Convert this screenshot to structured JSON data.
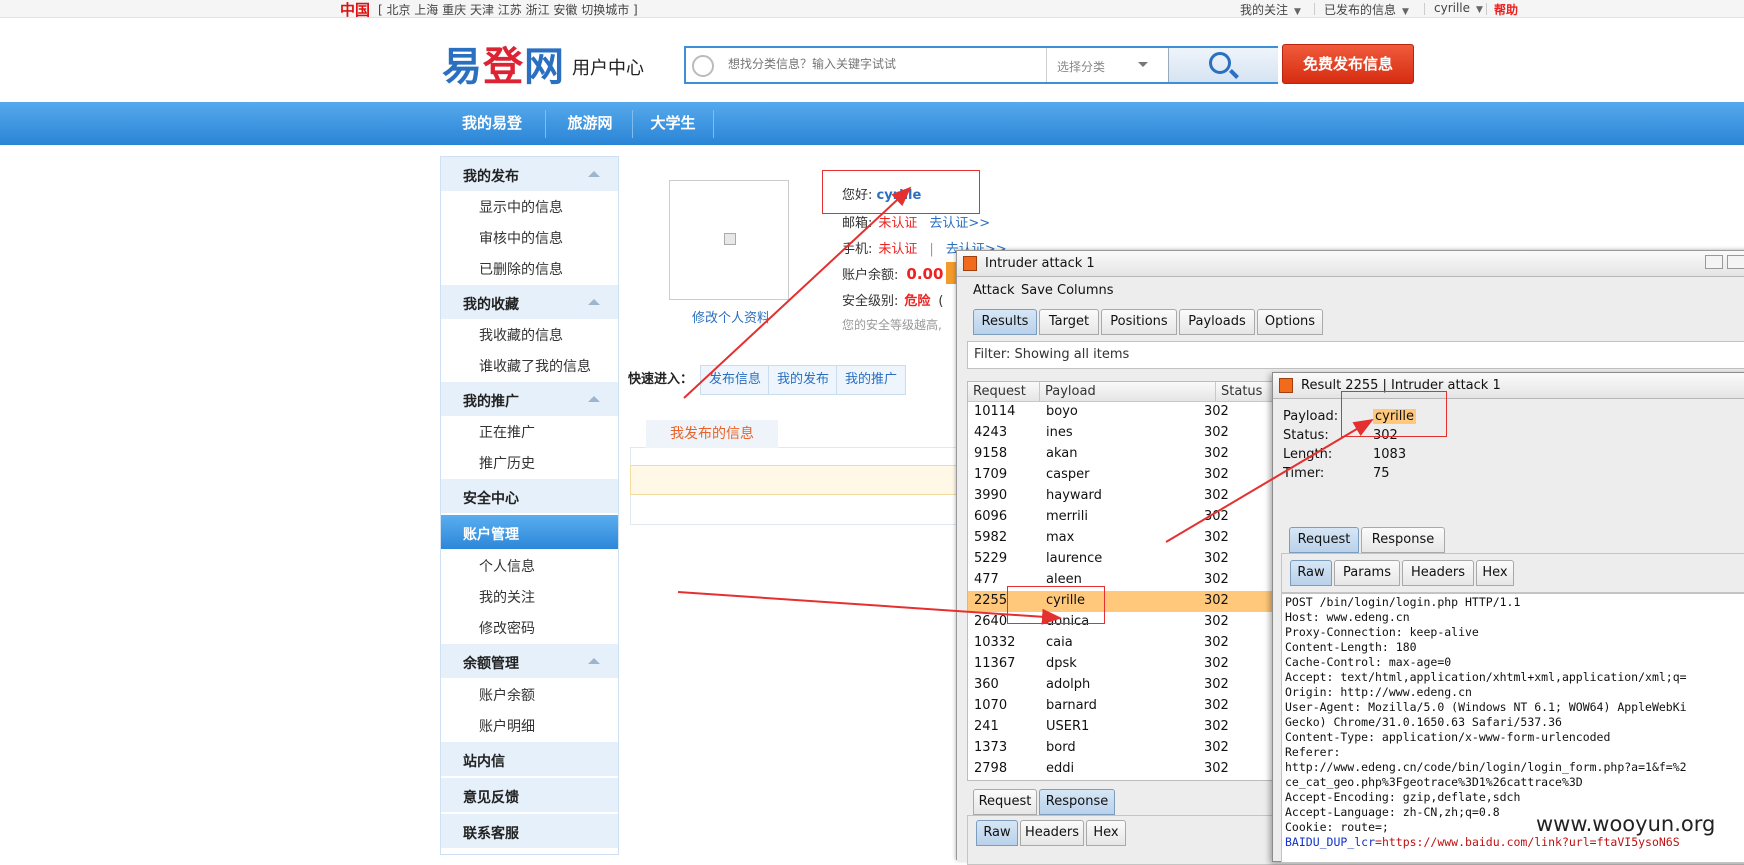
{
  "topbar": {
    "country": "中国",
    "cities": "[ 北京 上海 重庆 天津 江苏 浙江 安徽 切换城市 ]",
    "links": [
      "我的关注",
      "已发布的信息",
      "cyrille"
    ],
    "help": "帮助"
  },
  "header": {
    "logo_left": "易",
    "logo_mid": "登",
    "logo_right": "网",
    "subtitle": "用户中心",
    "search_placeholder": "想找分类信息？输入关键字试试",
    "category_placeholder": "选择分类",
    "publish_button": "免费发布信息"
  },
  "nav": [
    "我的易登",
    "旅游网",
    "大学生"
  ],
  "sidebar": {
    "groups": [
      {
        "title": "我的发布",
        "items": [
          "显示中的信息",
          "审核中的信息",
          "已删除的信息"
        ]
      },
      {
        "title": "我的收藏",
        "items": [
          "我收藏的信息",
          "谁收藏了我的信息"
        ]
      },
      {
        "title": "我的推广",
        "items": [
          "正在推广",
          "推广历史"
        ]
      },
      {
        "title": "安全中心",
        "items": []
      },
      {
        "title": "账户管理",
        "items": [
          "个人信息",
          "我的关注",
          "修改密码"
        ]
      },
      {
        "title": "余额管理",
        "items": [
          "账户余额",
          "账户明细"
        ]
      },
      {
        "title": "站内信",
        "items": []
      },
      {
        "title": "意见反馈",
        "items": []
      },
      {
        "title": "联系客服",
        "items": []
      }
    ]
  },
  "profile": {
    "edit_link": "修改个人资料",
    "greeting": "您好:",
    "username": "cyrille",
    "email_label": "邮箱:",
    "email_status": "未认证",
    "email_action": "去认证>>",
    "phone_label": "手机:",
    "phone_status": "未认证",
    "phone_sep": "|",
    "phone_action": "去认证>>",
    "balance_label": "账户余额:",
    "balance_value": "0.00",
    "security_label": "安全级别:",
    "security_value": "危险",
    "security_paren": "(",
    "security_tip": "您的安全等级越高,"
  },
  "quick": {
    "label": "快速进入：",
    "buttons": [
      "发布信息",
      "我的发布",
      "我的推广"
    ]
  },
  "my_posts_tab": "我发布的信息",
  "intruder": {
    "title": "Intruder attack 1",
    "menu": [
      "Attack",
      "Save",
      "Columns"
    ],
    "tabs": [
      "Results",
      "Target",
      "Positions",
      "Payloads",
      "Options"
    ],
    "filter": "Filter: Showing all items",
    "columns": [
      "Request",
      "Payload",
      "Status"
    ],
    "rows": [
      [
        "10114",
        "boyo",
        "302"
      ],
      [
        "4243",
        "ines",
        "302"
      ],
      [
        "9158",
        "akan",
        "302"
      ],
      [
        "1709",
        "casper",
        "302"
      ],
      [
        "3990",
        "hayward",
        "302"
      ],
      [
        "6096",
        "merrili",
        "302"
      ],
      [
        "5982",
        "max",
        "302"
      ],
      [
        "5229",
        "laurence",
        "302"
      ],
      [
        "477",
        "aleen",
        "302"
      ],
      [
        "2255",
        "cyrille",
        "302"
      ],
      [
        "2640",
        "donica",
        "302"
      ],
      [
        "10332",
        "caia",
        "302"
      ],
      [
        "11367",
        "dpsk",
        "302"
      ],
      [
        "360",
        "adolph",
        "302"
      ],
      [
        "1070",
        "barnard",
        "302"
      ],
      [
        "241",
        "USER1",
        "302"
      ],
      [
        "1373",
        "bord",
        "302"
      ],
      [
        "2798",
        "eddi",
        "302"
      ]
    ],
    "highlight_request": "2255",
    "lower_tabs": [
      "Request",
      "Response"
    ],
    "lower_subtabs": [
      "Raw",
      "Headers",
      "Hex"
    ]
  },
  "result": {
    "title": "Result 2255 | Intruder attack 1",
    "payload_label": "Payload:",
    "payload": "cyrille",
    "status_label": "Status:",
    "status": "302",
    "length_label": "Length:",
    "length": "1083",
    "timer_label": "Timer:",
    "timer": "75",
    "tabs": [
      "Request",
      "Response"
    ],
    "subtabs": [
      "Raw",
      "Params",
      "Headers",
      "Hex"
    ],
    "raw_lines": [
      "POST /bin/login/login.php HTTP/1.1",
      "Host: www.edeng.cn",
      "Proxy-Connection: keep-alive",
      "Content-Length: 180",
      "Cache-Control: max-age=0",
      "Accept: text/html,application/xhtml+xml,application/xml;q=",
      "Origin: http://www.edeng.cn",
      "User-Agent: Mozilla/5.0 (Windows NT 6.1; WOW64) AppleWebKi",
      "Gecko) Chrome/31.0.1650.63 Safari/537.36",
      "Content-Type: application/x-www-form-urlencoded",
      "Referer:",
      "http://www.edeng.cn/code/bin/login/login_form.php?a=1&f=%2",
      "ce_cat_geo.php%3Fgeotrace%3D1%26cattrace%3D",
      "Accept-Encoding: gzip,deflate,sdch",
      "Accept-Language: zh-CN,zh;q=0.8",
      "Cookie: route=;"
    ],
    "cookie_key": "BAIDU_DUP_lcr",
    "cookie_val": "=https://www.baidu.com/link?url=ftaVI5ysoN6S"
  },
  "watermark": "www.wooyun.org",
  "colors": {
    "brand_blue": "#2a6fc0",
    "nav_blue": "#2b85d6",
    "alert_red": "#e22",
    "highlight_row": "#ffc87a",
    "annotation_red": "#e53030"
  }
}
